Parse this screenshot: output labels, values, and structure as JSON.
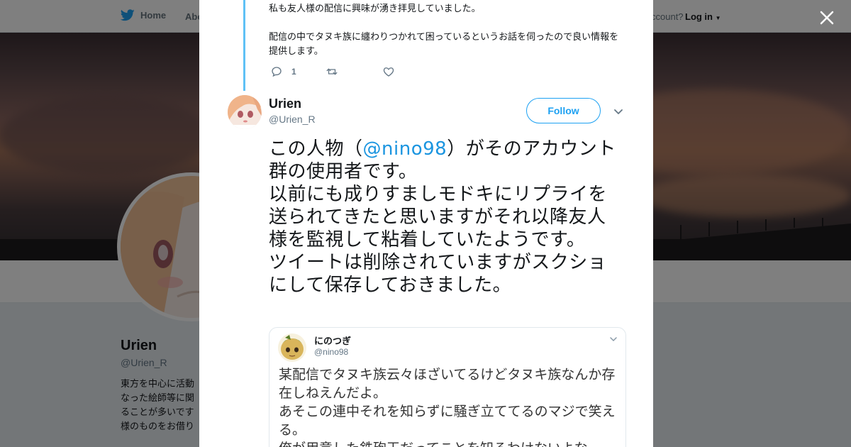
{
  "nav": {
    "home_label": "Home",
    "about_label": "Abo",
    "account_prompt": "ccount?",
    "login_label": "Log in"
  },
  "profile": {
    "name": "Urien",
    "handle": "@Urien_R",
    "bio_lines": [
      "東方を中心に活動",
      "なった絵師等に関",
      "ることが多いです",
      "様のものをお借り"
    ]
  },
  "previous_tweet": {
    "lines": [
      "私も友人様の配信に興味が湧き拝見していました。",
      "配信の中でタヌキ族に纏わりつかれて困っているというお話を伺ったので良い情報を提供します。"
    ],
    "reply_count": "1"
  },
  "tweet": {
    "author_name": "Urien",
    "author_handle": "@Urien_R",
    "follow_label": "Follow",
    "text_before_mention": "この人物（",
    "mention": "@nino98",
    "text_after_mention": "）がそのアカウント群の使用者です。",
    "text_rest": [
      "以前にも成りすましモドキにリプライを送られてきたと思いますがそれ以降友人様を監視して粘着していたようです。",
      "ツイートは削除されていますがスクショにして保存しておきました。"
    ]
  },
  "embedded_screenshot": {
    "name": "にのつぎ",
    "handle": "@nino98",
    "lines": [
      "某配信でタヌキ族云々ほざいてるけどタヌキ族なんか存在しねえんだよ。",
      "あそこの連中それを知らずに騒ぎ立ててるのマジで笑える。",
      "俺が用意した鉄砲玉だってことを知るわけないよな"
    ]
  },
  "colors": {
    "twitter_blue": "#1da1f2",
    "link_blue": "#1b95e0",
    "thread_line": "#5fc1f5",
    "text_primary": "#14171a",
    "text_secondary": "#657786"
  },
  "icons": {
    "logo": "twitter-bird-icon",
    "close": "close-icon",
    "reply": "reply-icon",
    "retweet": "retweet-icon",
    "like": "heart-icon",
    "more": "chevron-down-icon"
  }
}
